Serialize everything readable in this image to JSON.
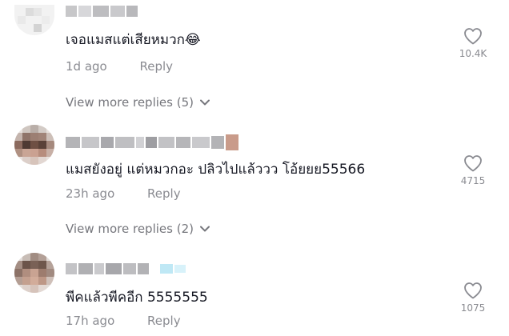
{
  "comments": [
    {
      "text": "เจอแมสแต่เสียหมวก😂",
      "time": "1d ago",
      "reply_label": "Reply",
      "likes": "10.4K"
    },
    {
      "text": "แมสยังอยู่ แต่หมวกอะ ปลิวไปแล้ววว โอ้ยยย55566",
      "time": "23h ago",
      "reply_label": "Reply",
      "likes": "4715"
    },
    {
      "text": "พีคแล้วพีคอีก 5555555",
      "time": "17h ago",
      "reply_label": "Reply",
      "likes": "1075"
    }
  ],
  "view_more": [
    {
      "label": "View more replies (5)"
    },
    {
      "label": "View more replies (2)"
    }
  ],
  "colors": {
    "text": "#161823",
    "meta": "#8a8b91",
    "view_more": "#75767c",
    "heart": "#8a8b91"
  },
  "icons": {
    "like": "heart-outline-icon",
    "expand": "chevron-down-icon"
  }
}
